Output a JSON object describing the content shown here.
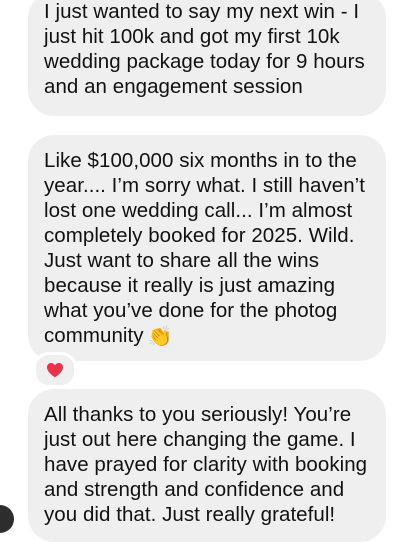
{
  "messages": [
    {
      "lines": [
        "I just wanted to say my next win - I",
        "just hit 100k and got my first 10k",
        "wedding package today for 9 hours",
        "and an engagement session"
      ]
    },
    {
      "lines": [
        "Like $100,000 six months in to the",
        "year.... I’m sorry what. I still haven’t",
        "lost one wedding call... I’m almost",
        "completely booked for 2025. Wild.",
        "Just want to share all the wins",
        "because it really is just amazing",
        "what you’ve done for the photog",
        "community"
      ],
      "emoji": "👏",
      "reaction": "heart"
    },
    {
      "lines": [
        "All thanks to you seriously! You’re",
        "just out here changing the game. I",
        "have prayed for clarity with booking",
        "and strength and confidence and",
        "you did that. Just really grateful!"
      ]
    }
  ],
  "colors": {
    "bubble": "#efefef",
    "text": "#111111",
    "heart": "#e8334a"
  }
}
